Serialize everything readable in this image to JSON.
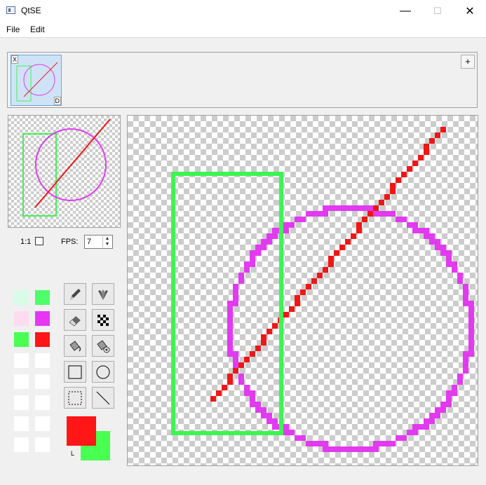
{
  "window": {
    "title": "QtSE",
    "minimize": "—",
    "maximize": "☐",
    "close": "✕"
  },
  "menu": {
    "items": [
      "File",
      "Edit"
    ]
  },
  "frames": {
    "tag_remove": "X",
    "tag_duplicate": "D",
    "add_label": "+"
  },
  "preview": {
    "scale_label": "1:1",
    "fps_label": "FPS:",
    "fps_value": "7",
    "spin_up": "▲",
    "spin_down": "▼"
  },
  "palette": {
    "colors": [
      "#d9fce8",
      "#4dfd6a",
      "#fcdcee",
      "#e536f3",
      "#49ff52",
      "#ff1616",
      "#ffffff",
      "#ffffff",
      "#ffffff",
      "#ffffff",
      "#ffffff",
      "#ffffff",
      "#ffffff",
      "#ffffff",
      "#ffffff",
      "#ffffff"
    ]
  },
  "tools": {
    "icons": [
      "pencil-icon",
      "spray-icon",
      "eraser-icon",
      "checker-fill-icon",
      "bucket-icon",
      "bucket-pattern-icon",
      "rectangle-icon",
      "ellipse-icon",
      "selection-icon",
      "line-icon"
    ]
  },
  "colors": {
    "primary": "#ff1616",
    "secondary": "#49ff52",
    "primary_label": "L",
    "rect": "#3cf552",
    "ellipse": "#e23af0",
    "line": "#f01616"
  }
}
